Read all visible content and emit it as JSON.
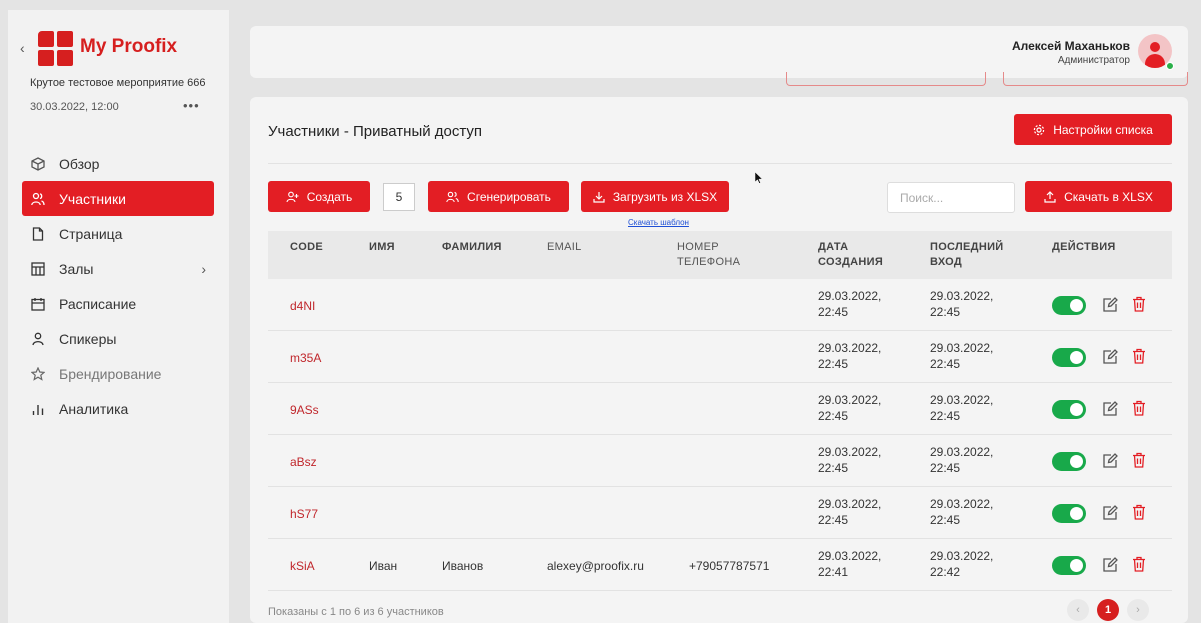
{
  "app": {
    "brand": "My Proofix",
    "event_name": "Крутое тестовое мероприятие 666",
    "event_date": "30.03.2022, 12:00",
    "more": "•••"
  },
  "sidebar": {
    "items": [
      {
        "label": "Обзор",
        "icon": "cube-icon"
      },
      {
        "label": "Участники",
        "icon": "users-icon",
        "active": true
      },
      {
        "label": "Страница",
        "icon": "file-icon"
      },
      {
        "label": "Залы",
        "icon": "layout-icon"
      },
      {
        "label": "Расписание",
        "icon": "calendar-icon"
      },
      {
        "label": "Спикеры",
        "icon": "user-icon"
      },
      {
        "label": "Брендирование",
        "icon": "star-icon"
      },
      {
        "label": "Аналитика",
        "icon": "bar-chart-icon"
      }
    ]
  },
  "header": {
    "user_name": "Алексей Маханьков",
    "user_role": "Администратор"
  },
  "panel": {
    "title": "Участники - Приватный доступ",
    "settings_label": "Настройки списка",
    "create_label": "Создать",
    "count_value": "5",
    "generate_label": "Сгенерировать",
    "upload_label": "Загрузить из XLSX",
    "template_link": "Скачать шаблон",
    "search_placeholder": "Поиск...",
    "download_label": "Скачать в XLSX"
  },
  "table": {
    "columns": {
      "code": "CODE",
      "first_name": "ИМЯ",
      "last_name": "ФАМИЛИЯ",
      "email": "EMAIL",
      "phone_1": "НОМЕР",
      "phone_2": "ТЕЛЕФОНА",
      "created_1": "ДАТА",
      "created_2": "СОЗДАНИЯ",
      "last_login_1": "ПОСЛЕДНИЙ",
      "last_login_2": "ВХОД",
      "actions": "ДЕЙСТВИЯ"
    },
    "rows": [
      {
        "code": "d4NI",
        "first_name": "",
        "last_name": "",
        "email": "",
        "phone": "",
        "created_1": "29.03.2022,",
        "created_2": "22:45",
        "login_1": "29.03.2022,",
        "login_2": "22:45",
        "enabled": true
      },
      {
        "code": "m35A",
        "first_name": "",
        "last_name": "",
        "email": "",
        "phone": "",
        "created_1": "29.03.2022,",
        "created_2": "22:45",
        "login_1": "29.03.2022,",
        "login_2": "22:45",
        "enabled": true
      },
      {
        "code": "9ASs",
        "first_name": "",
        "last_name": "",
        "email": "",
        "phone": "",
        "created_1": "29.03.2022,",
        "created_2": "22:45",
        "login_1": "29.03.2022,",
        "login_2": "22:45",
        "enabled": true
      },
      {
        "code": "aBsz",
        "first_name": "",
        "last_name": "",
        "email": "",
        "phone": "",
        "created_1": "29.03.2022,",
        "created_2": "22:45",
        "login_1": "29.03.2022,",
        "login_2": "22:45",
        "enabled": true
      },
      {
        "code": "hS77",
        "first_name": "",
        "last_name": "",
        "email": "",
        "phone": "",
        "created_1": "29.03.2022,",
        "created_2": "22:45",
        "login_1": "29.03.2022,",
        "login_2": "22:45",
        "enabled": true
      },
      {
        "code": "kSiA",
        "first_name": "Иван",
        "last_name": "Иванов",
        "email": "alexey@proofix.ru",
        "phone": "+79057787571",
        "created_1": "29.03.2022,",
        "created_2": "22:41",
        "login_1": "29.03.2022,",
        "login_2": "22:42",
        "enabled": true
      }
    ]
  },
  "footer": {
    "summary": "Показаны с 1 по 6 из 6 участников",
    "current_page": "1",
    "prev": "‹",
    "next": "›"
  },
  "colors": {
    "accent": "#e31e24",
    "toggle_on": "#18a94a",
    "link": "#1e4fd6"
  }
}
